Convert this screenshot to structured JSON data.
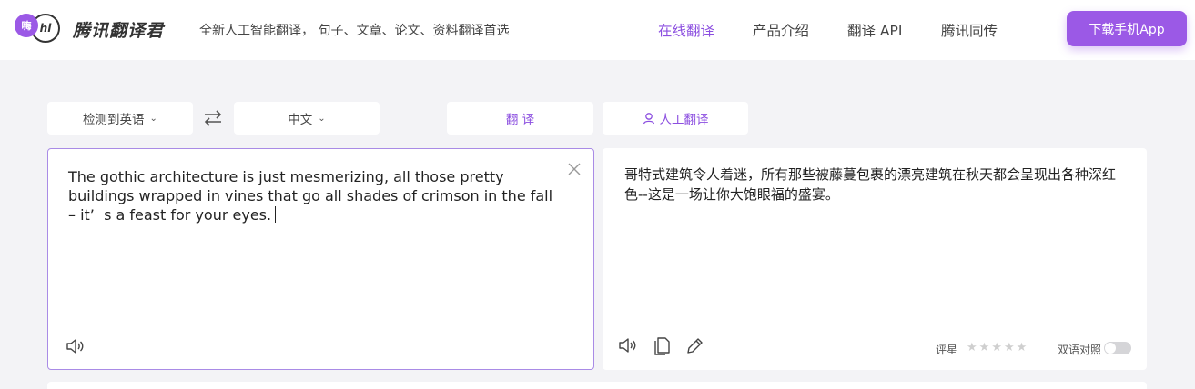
{
  "header": {
    "logo_badge": "嗨",
    "logo_hi": "hi",
    "brand": "腾讯翻译君",
    "slogan": "全新人工智能翻译， 句子、文章、论文、资料翻译首选",
    "nav": [
      {
        "label": "在线翻译",
        "active": true
      },
      {
        "label": "产品介绍",
        "active": false
      },
      {
        "label": "翻译 API",
        "active": false
      },
      {
        "label": "腾讯同传",
        "active": false
      }
    ],
    "download_label": "下载手机App"
  },
  "controls": {
    "source_lang": "检测到英语",
    "target_lang": "中文",
    "translate_label": "翻 译",
    "human_translate_label": "人工翻译"
  },
  "source": {
    "text": "The gothic architecture is just mesmerizing, all those pretty buildings wrapped in vines that go all shades of crimson in the fall – it’  s a feast for your eyes."
  },
  "target": {
    "text": "哥特式建筑令人着迷，所有那些被藤蔓包裹的漂亮建筑在秋天都会呈现出各种深红色--这是一场让你大饱眼福的盛宴。",
    "rating_label": "评星",
    "rating_value": 0,
    "rating_max": 5,
    "bilingual_label": "双语对照",
    "bilingual_on": false
  },
  "colors": {
    "accent": "#9b59e6",
    "accent_text": "#8c4fe0",
    "page_bg": "#f3f3f6"
  },
  "icons": {
    "swap": "swap-arrows-icon",
    "clear": "close-icon",
    "speaker": "speaker-icon",
    "copy": "copy-icon",
    "edit": "pencil-icon",
    "human": "person-icon",
    "star": "star-icon"
  }
}
